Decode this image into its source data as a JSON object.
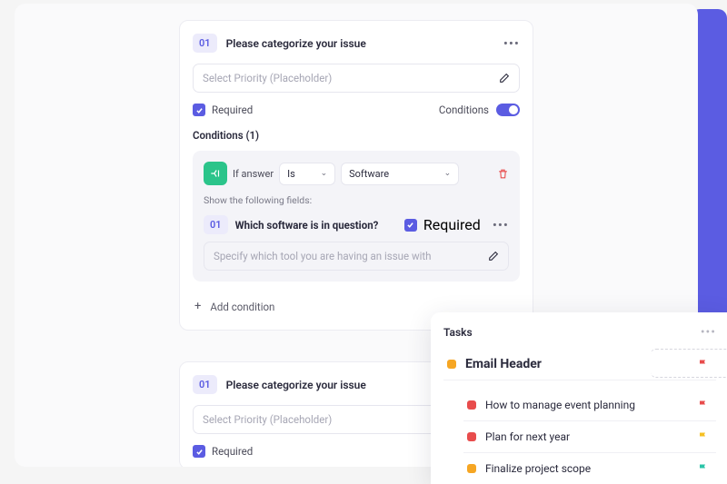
{
  "form": {
    "field1": {
      "number": "01",
      "label": "Please categorize your issue",
      "placeholder": "Select Priority (Placeholder)",
      "required_label": "Required",
      "conditions_label": "Conditions"
    },
    "conditions": {
      "heading": "Conditions (1)",
      "if_answer": "If answer",
      "operator": "Is",
      "value": "Software",
      "show_label": "Show the following fields:",
      "nested_number": "01",
      "nested_title": "Which software is in question?",
      "nested_required": "Required",
      "nested_placeholder": "Specify which tool you are having an issue with",
      "add_condition": "Add condition"
    },
    "field2": {
      "number": "01",
      "label": "Please categorize your issue",
      "placeholder": "Select Priority (Placeholder)",
      "required_label": "Required"
    }
  },
  "tasks": {
    "title": "Tasks",
    "featured": {
      "name": "Email Header",
      "status_color": "#f6a623",
      "flag_color": "#e84c4c"
    },
    "items": [
      {
        "name": "How to manage event planning",
        "status_color": "#e84c4c",
        "flag_color": "#e84c4c"
      },
      {
        "name": "Plan for next year",
        "status_color": "#e84c4c",
        "flag_color": "#f6c023"
      },
      {
        "name": "Finalize project scope",
        "status_color": "#f6a623",
        "flag_color": "#2bc4a8"
      }
    ]
  }
}
